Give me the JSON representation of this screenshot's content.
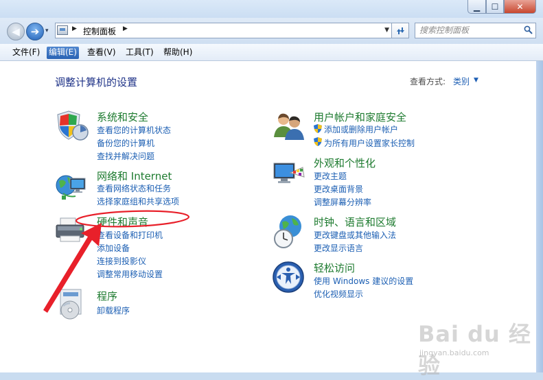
{
  "window": {
    "controls": {
      "minimize": "▁",
      "maximize": "☐",
      "close": "✕"
    }
  },
  "nav": {
    "back_icon": "◀",
    "forward_icon": "➔",
    "dropdown_icon": "▾"
  },
  "address": {
    "breadcrumb": "控制面板",
    "separator": "▶",
    "dropdown_icon": "▼"
  },
  "search": {
    "placeholder": "搜索控制面板"
  },
  "menu": {
    "items": [
      "文件(F)",
      "编辑(E)",
      "查看(V)",
      "工具(T)",
      "帮助(H)"
    ],
    "active_index": 1
  },
  "main": {
    "heading": "调整计算机的设置",
    "view_by_label": "查看方式:",
    "view_by_value": "类别",
    "categories": [
      {
        "title": "系统和安全",
        "links": [
          "查看您的计算机状态",
          "备份您的计算机",
          "查找并解决问题"
        ],
        "icon": "shield-flag-icon"
      },
      {
        "title": "网络和 Internet",
        "links": [
          "查看网络状态和任务",
          "选择家庭组和共享选项"
        ],
        "icon": "globe-network-icon"
      },
      {
        "title": "硬件和声音",
        "links": [
          "查看设备和打印机",
          "添加设备",
          "连接到投影仪",
          "调整常用移动设置"
        ],
        "icon": "printer-hardware-icon"
      },
      {
        "title": "程序",
        "links": [
          "卸载程序"
        ],
        "icon": "programs-disc-icon"
      },
      {
        "title": "用户帐户和家庭安全",
        "links": [
          "添加或删除用户帐户",
          "为所有用户设置家长控制"
        ],
        "icon": "users-icon"
      },
      {
        "title": "外观和个性化",
        "links": [
          "更改主题",
          "更改桌面背景",
          "调整屏幕分辨率"
        ],
        "icon": "monitor-palette-icon"
      },
      {
        "title": "时钟、语言和区域",
        "links": [
          "更改键盘或其他输入法",
          "更改显示语言"
        ],
        "icon": "clock-globe-icon"
      },
      {
        "title": "轻松访问",
        "links": [
          "使用 Windows 建议的设置",
          "优化视频显示"
        ],
        "icon": "ease-of-access-icon"
      }
    ]
  },
  "colors": {
    "category_title": "#1c7a2e",
    "link": "#1c5fb3",
    "heading": "#1e3287",
    "annotation_red": "#e8202a"
  },
  "watermark": {
    "text": "Bai du 经验",
    "url": "jingyan.baidu.com"
  }
}
